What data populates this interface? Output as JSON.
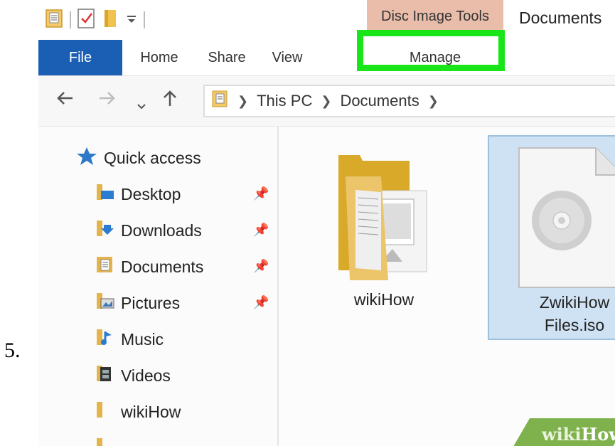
{
  "step_number": "5.",
  "titlebar": {
    "context_tab": "Disc Image Tools",
    "window_title": "Documents"
  },
  "ribbon": {
    "tabs": [
      "File",
      "Home",
      "Share",
      "View",
      "Manage"
    ],
    "highlighted_tab": "Manage",
    "highlight_color": "#19e619",
    "file_tab_color": "#1a5fb4"
  },
  "address": {
    "back_icon": "back-arrow-icon",
    "forward_icon": "forward-arrow-icon",
    "up_icon": "up-arrow-icon",
    "crumbs": [
      "This PC",
      "Documents"
    ]
  },
  "sidebar": {
    "items": [
      {
        "label": "Quick access",
        "icon": "star-icon"
      },
      {
        "label": "Desktop",
        "icon": "desktop-folder-icon"
      },
      {
        "label": "Downloads",
        "icon": "downloads-folder-icon"
      },
      {
        "label": "Documents",
        "icon": "documents-folder-icon"
      },
      {
        "label": "Pictures",
        "icon": "pictures-folder-icon"
      },
      {
        "label": "Music",
        "icon": "music-folder-icon"
      },
      {
        "label": "Videos",
        "icon": "videos-folder-icon"
      },
      {
        "label": "wikiHow",
        "icon": "folder-icon"
      }
    ]
  },
  "content": {
    "files": [
      {
        "name": "wikiHow",
        "type": "folder"
      },
      {
        "name_line1": "ZwikiHow",
        "name_line2": "Files.iso",
        "type": "disc-image",
        "selected": true
      }
    ]
  },
  "watermark": {
    "part1": "wiki",
    "part2": "How"
  }
}
